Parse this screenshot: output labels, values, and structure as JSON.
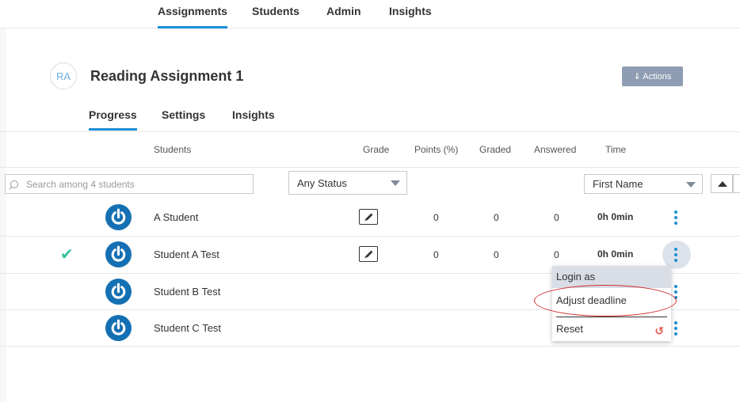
{
  "topnav": {
    "tabs": [
      "Assignments",
      "Students",
      "Admin",
      "Insights"
    ],
    "active": "Assignments"
  },
  "assignment": {
    "avatar_initials": "RA",
    "title": "Reading Assignment 1",
    "actions_label": "⇓ Actions"
  },
  "subtabs": {
    "tabs": [
      "Progress",
      "Settings",
      "Insights"
    ],
    "active": "Progress"
  },
  "columns": {
    "students": "Students",
    "grade": "Grade",
    "points": "Points (%)",
    "graded": "Graded",
    "answered": "Answered",
    "time": "Time"
  },
  "filters": {
    "search_placeholder": "Search among 4 students",
    "status_value": "Any Status",
    "sort_value": "First Name"
  },
  "rows": [
    {
      "name": "A Student",
      "points": "0",
      "graded": "0",
      "answered": "0",
      "time": "0h 0min",
      "checked": false
    },
    {
      "name": "Student A Test",
      "points": "0",
      "graded": "0",
      "answered": "0",
      "time": "0h 0min",
      "checked": true
    },
    {
      "name": "Student B Test",
      "points": "",
      "graded": "",
      "answered": "",
      "time": "",
      "checked": false
    },
    {
      "name": "Student C Test",
      "points": "",
      "graded": "",
      "answered": "",
      "time": "",
      "checked": false
    }
  ],
  "menu": {
    "items": [
      "Login as",
      "Adjust deadline",
      "Reset"
    ],
    "highlighted": "Login as"
  },
  "colors": {
    "accent": "#1a8fd6",
    "student_icon": "#1570b3",
    "check": "#36c2a2",
    "annotation": "#d62b2b",
    "actions_button": "#8e9db3"
  },
  "icons": {
    "student": "power-icon",
    "grade": "pen-icon",
    "search": "search-icon",
    "more": "vertical-dots-icon",
    "reset": "undo-icon",
    "check": "check-icon"
  }
}
